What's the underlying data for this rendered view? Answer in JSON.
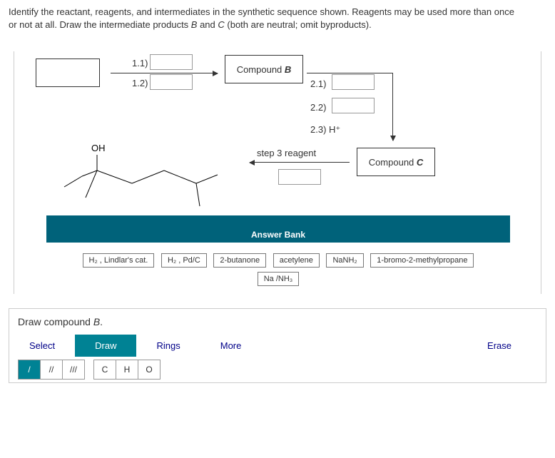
{
  "question": {
    "line1": "Identify the reactant, reagents, and intermediates in the synthetic sequence shown. Reagents may be used more than once",
    "line2_a": "or not at all. Draw the intermediate products ",
    "line2_b": "B",
    "line2_c": " and ",
    "line2_d": "C",
    "line2_e": " (both are neutral; omit byproducts)."
  },
  "diagram": {
    "step11": "1.1)",
    "step12": "1.2)",
    "compoundB_a": "Compound ",
    "compoundB_b": "B",
    "step21": "2.1)",
    "step22": "2.2)",
    "step23": "2.3) H⁺",
    "step3": "step 3 reagent",
    "compoundC_a": "Compound ",
    "compoundC_b": "C",
    "oh": "OH"
  },
  "bank": {
    "title": "Answer Bank",
    "items": [
      "H₂ , Lindlar's cat.",
      "H₂ , Pd/C",
      "2-butanone",
      "acetylene",
      "NaNH₂",
      "1-bromo-2-methylpropane",
      "Na /NH₃"
    ]
  },
  "draw": {
    "title_a": "Draw compound ",
    "title_b": "B",
    "title_c": ".",
    "tabs": {
      "select": "Select",
      "draw": "Draw",
      "rings": "Rings",
      "more": "More",
      "erase": "Erase"
    },
    "tools": {
      "single": "/",
      "double": "//",
      "triple": "///",
      "c": "C",
      "h": "H",
      "o": "O"
    }
  }
}
